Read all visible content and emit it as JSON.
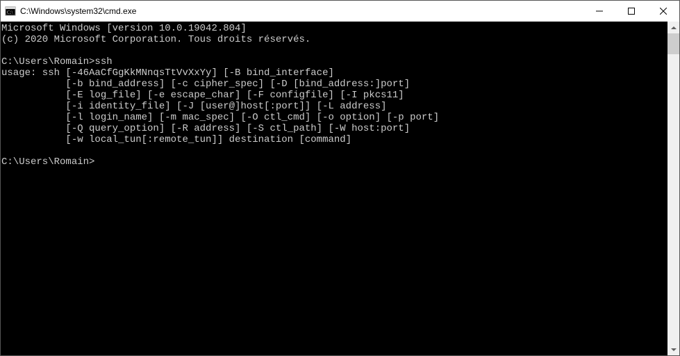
{
  "window": {
    "title": "C:\\Windows\\system32\\cmd.exe"
  },
  "terminal": {
    "lines": [
      "Microsoft Windows [version 10.0.19042.804]",
      "(c) 2020 Microsoft Corporation. Tous droits réservés.",
      "",
      "C:\\Users\\Romain>ssh",
      "usage: ssh [-46AaCfGgKkMNnqsTtVvXxYy] [-B bind_interface]",
      "           [-b bind_address] [-c cipher_spec] [-D [bind_address:]port]",
      "           [-E log_file] [-e escape_char] [-F configfile] [-I pkcs11]",
      "           [-i identity_file] [-J [user@]host[:port]] [-L address]",
      "           [-l login_name] [-m mac_spec] [-O ctl_cmd] [-o option] [-p port]",
      "           [-Q query_option] [-R address] [-S ctl_path] [-W host:port]",
      "           [-w local_tun[:remote_tun]] destination [command]",
      "",
      "C:\\Users\\Romain>"
    ]
  }
}
